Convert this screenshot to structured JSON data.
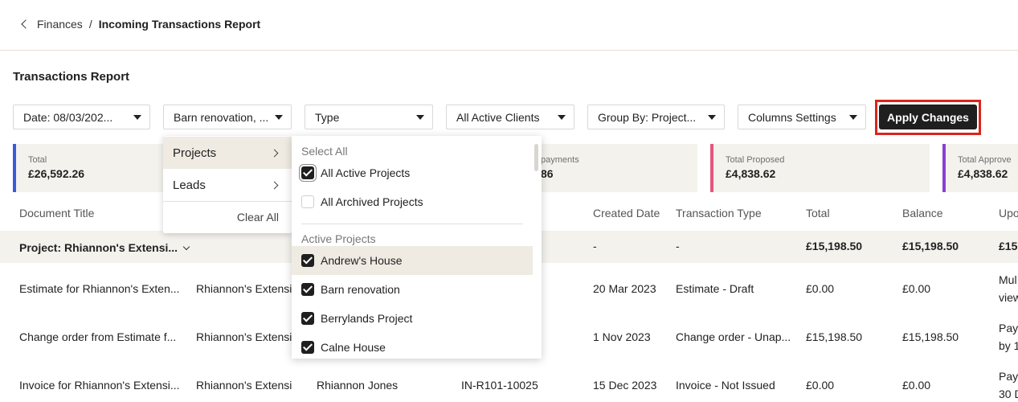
{
  "breadcrumb": {
    "parent": "Finances",
    "separator": "/",
    "current": "Incoming Transactions Report"
  },
  "page_title": "Transactions Report",
  "filters": {
    "date": "Date: 08/03/202...",
    "projects": "Barn renovation, ...",
    "type": "Type",
    "clients": "All Active Clients",
    "group_by": "Group By: Project...",
    "columns": "Columns Settings"
  },
  "apply_button": "Apply Changes",
  "accent_colors": {
    "total": "#3a5bd9",
    "payments": "#d9d6d0",
    "proposed": "#e8557a",
    "approved": "#8a3fd1",
    "highlight": "#d9261c"
  },
  "cards": [
    {
      "label": "Total",
      "value": "£26,592.26"
    },
    {
      "label": "payments",
      "value": "86"
    },
    {
      "label": "Total Proposed",
      "value": "£4,838.62"
    },
    {
      "label": "Total Approve",
      "value": "£4,838.62"
    }
  ],
  "table": {
    "headers": [
      "Document Title",
      "Created Date",
      "Transaction Type",
      "Total",
      "Balance",
      "Upo"
    ],
    "group_row": {
      "title": "Project: Rhiannon's Extensi...",
      "created": "-",
      "type": "-",
      "total": "£15,198.50",
      "balance": "£15,198.50",
      "extra": "£15,"
    },
    "rows": [
      {
        "title": "Estimate for Rhiannon's Exten...",
        "project": "Rhiannon's Extensi",
        "client": "",
        "number": "",
        "created": "20 Mar 2023",
        "type": "Estimate - Draft",
        "total": "£0.00",
        "balance": "£0.00",
        "extra1": "Mul",
        "extra2": "view"
      },
      {
        "title": "Change order from Estimate f...",
        "project": "Rhiannon's Extensi",
        "client": "",
        "number": "",
        "created": "1 Nov 2023",
        "type": "Change order - Unap...",
        "total": "£15,198.50",
        "balance": "£15,198.50",
        "extra1": "Pay",
        "extra2": "by 1"
      },
      {
        "title": "Invoice for Rhiannon's Extensi...",
        "project": "Rhiannon's Extensi",
        "client": "Rhiannon Jones",
        "number": "IN-R101-10025",
        "created": "15 Dec 2023",
        "type": "Invoice - Not Issued",
        "total": "£0.00",
        "balance": "£0.00",
        "extra1": "Pay",
        "extra2": "30 D"
      }
    ]
  },
  "menu_left": {
    "items": [
      "Projects",
      "Leads"
    ],
    "clear": "Clear All"
  },
  "menu_right": {
    "select_all": "Select All",
    "options_top": [
      {
        "label": "All Active Projects",
        "checked": true
      },
      {
        "label": "All Archived Projects",
        "checked": false
      }
    ],
    "section_active": "Active Projects",
    "options_active": [
      {
        "label": "Andrew's House",
        "checked": true
      },
      {
        "label": "Barn renovation",
        "checked": true
      },
      {
        "label": "Berrylands Project",
        "checked": true
      },
      {
        "label": "Calne House",
        "checked": true
      }
    ]
  }
}
